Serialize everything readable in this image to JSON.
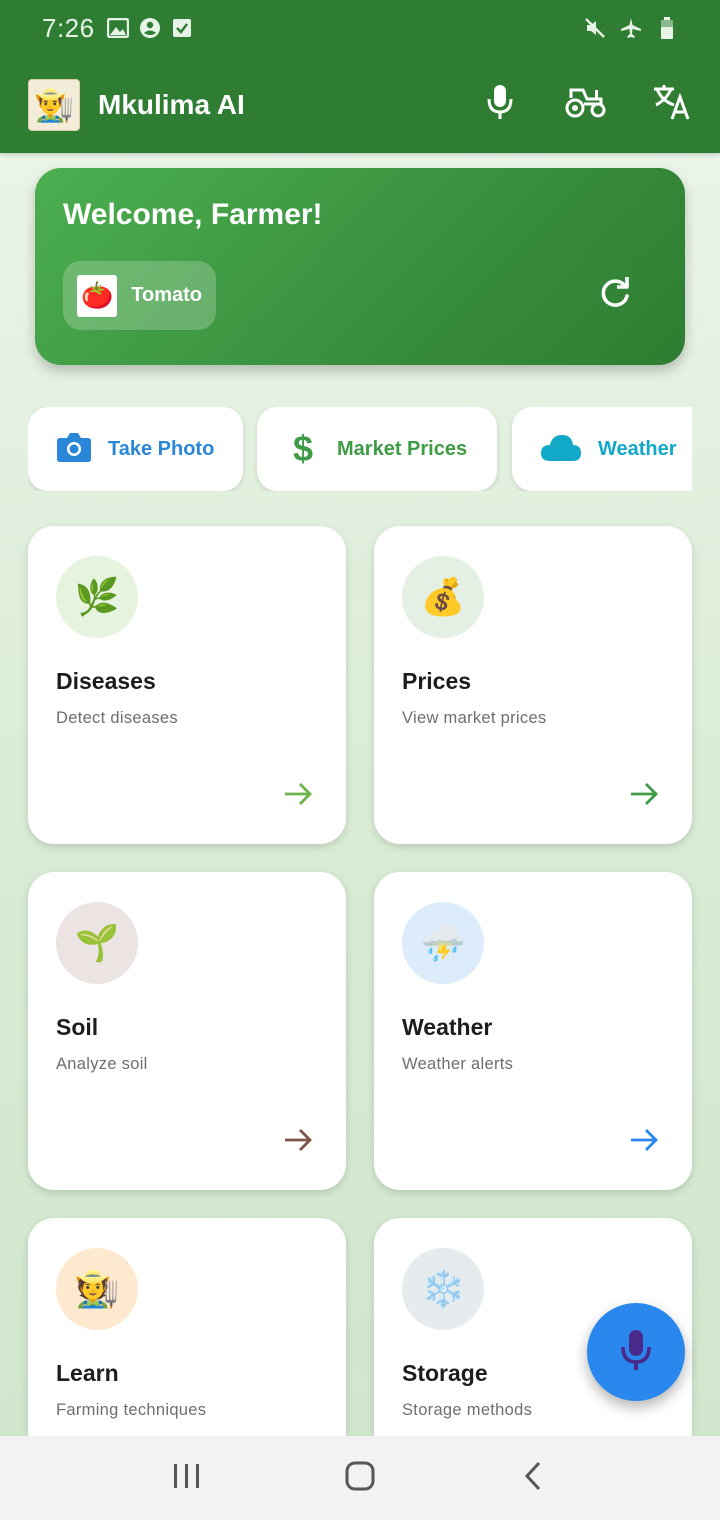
{
  "status_bar": {
    "time": "7:26",
    "left_icons": [
      "image-icon",
      "account-circle-icon",
      "checkbox-icon"
    ],
    "right_icons": [
      "mute-icon",
      "airplane-icon",
      "battery-icon"
    ]
  },
  "app_bar": {
    "title": "Mkulima AI",
    "actions": [
      "microphone-icon",
      "tractor-icon",
      "translate-icon"
    ],
    "color": "#2e7d32"
  },
  "welcome": {
    "title": "Welcome, Farmer!",
    "crop": {
      "emoji": "🍅",
      "label": "Tomato"
    }
  },
  "quick_actions": [
    {
      "label": "Take Photo",
      "icon": "camera-icon",
      "color": "#2a87d8"
    },
    {
      "label": "Market Prices",
      "icon": "dollar-icon",
      "color": "#3f9b45"
    },
    {
      "label": "Weather",
      "icon": "cloud-icon",
      "color": "#12a9c9"
    }
  ],
  "cards": [
    {
      "title": "Diseases",
      "subtitle": "Detect diseases",
      "emoji": "🌿",
      "icon_bg": "#e6f3df",
      "arrow_color": "#6cb24a"
    },
    {
      "title": "Prices",
      "subtitle": "View market prices",
      "emoji": "💰",
      "icon_bg": "#e3f0e3",
      "arrow_color": "#3f9b45"
    },
    {
      "title": "Soil",
      "subtitle": "Analyze soil",
      "emoji": "🌱",
      "icon_bg": "#ebe4e2",
      "arrow_color": "#7a5548"
    },
    {
      "title": "Weather",
      "subtitle": "Weather alerts",
      "emoji": "⛈️",
      "icon_bg": "#dcecfb",
      "arrow_color": "#2a87ee"
    },
    {
      "title": "Learn",
      "subtitle": "Farming techniques",
      "emoji": "🧑‍🌾",
      "icon_bg": "#fde9cf",
      "arrow_color": "#e08a1e"
    },
    {
      "title": "Storage",
      "subtitle": "Storage methods",
      "emoji": "❄️",
      "icon_bg": "#e6ebee",
      "arrow_color": "#607d8b"
    }
  ],
  "fab": {
    "icon": "microphone-icon",
    "color": "#2a87ee"
  },
  "nav_bar": [
    "recent-apps-icon",
    "home-icon",
    "back-icon"
  ]
}
